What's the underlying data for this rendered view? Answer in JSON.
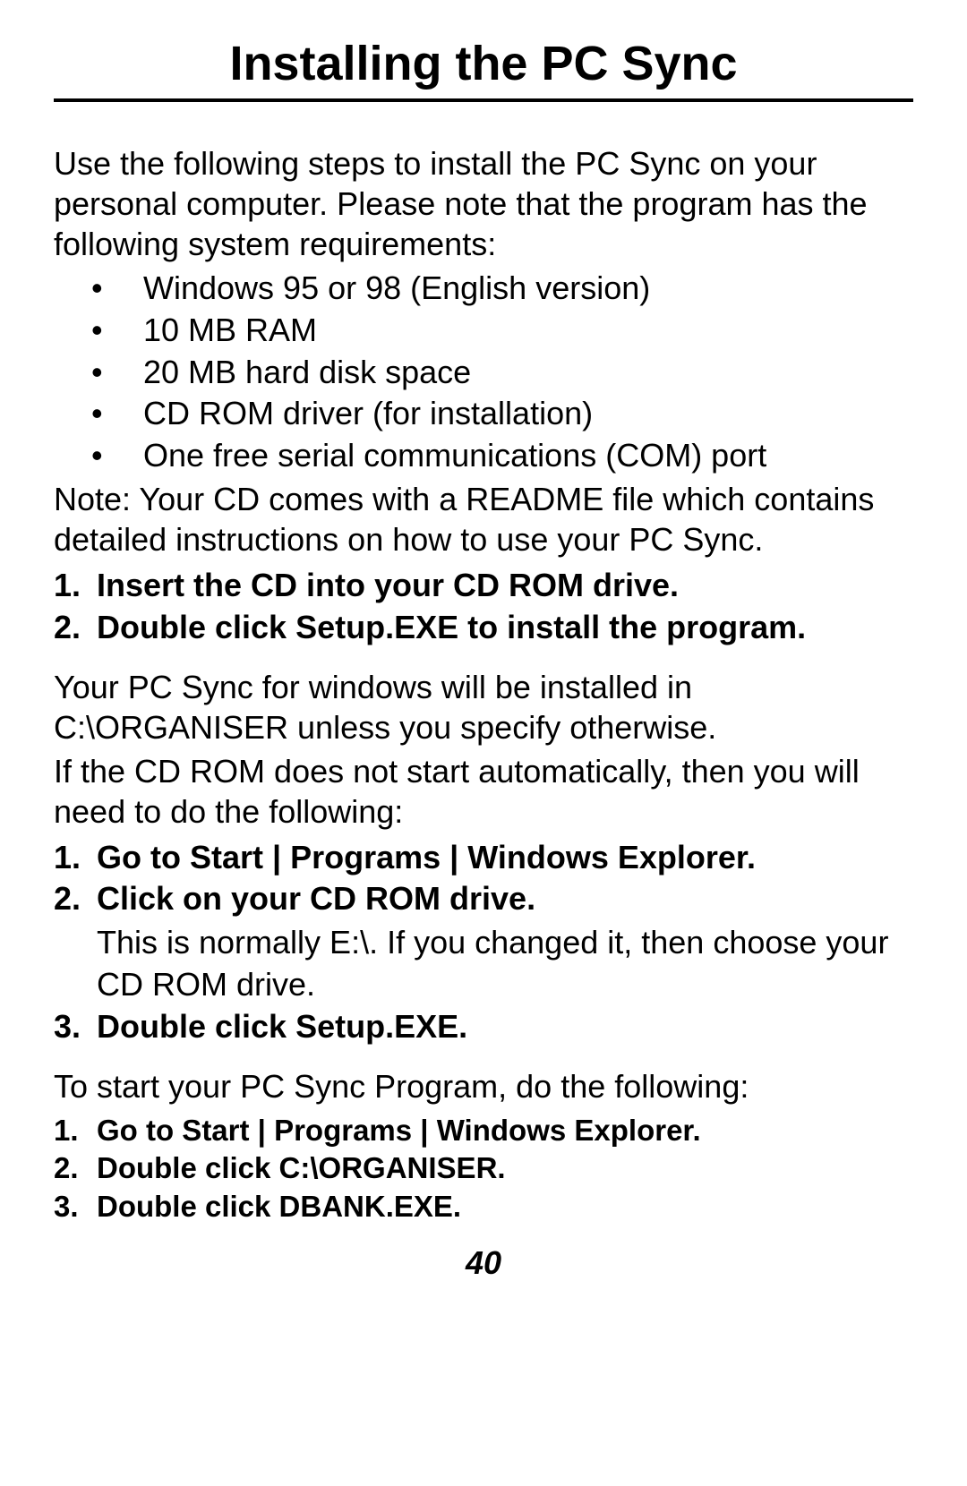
{
  "title": "Installing the PC Sync",
  "intro": "Use the following steps to install the PC Sync on your personal computer. Please note that the program has the following system requirements:",
  "requirements": [
    "Windows 95 or 98 (English version)",
    "10 MB RAM",
    "20 MB hard disk space",
    "CD ROM driver (for installation)",
    "One free serial communications (COM) port"
  ],
  "note": "Note: Your CD comes with a README file which contains detailed instructions on how to use your PC Sync.",
  "steps1": [
    "Insert the CD into your CD ROM drive.",
    "Double click Setup.EXE to install the program."
  ],
  "para1": "Your PC Sync for windows will be installed in C:\\ORGANISER  unless you specify otherwise.",
  "para2": "If the CD ROM does not start automatically, then you will need to do the following:",
  "steps2": [
    {
      "text": "Go to Start | Programs | Windows Explorer."
    },
    {
      "text": "Click on your CD ROM drive.",
      "sub": "This is normally E:\\. If you changed it, then choose your CD ROM drive."
    },
    {
      "text": "Double click Setup.EXE."
    }
  ],
  "para3": "To start your PC Sync Program, do the following:",
  "steps3": [
    "Go to Start | Programs | Windows Explorer.",
    "Double click C:\\ORGANISER.",
    "Double click DBANK.EXE."
  ],
  "pageNumber": "40"
}
